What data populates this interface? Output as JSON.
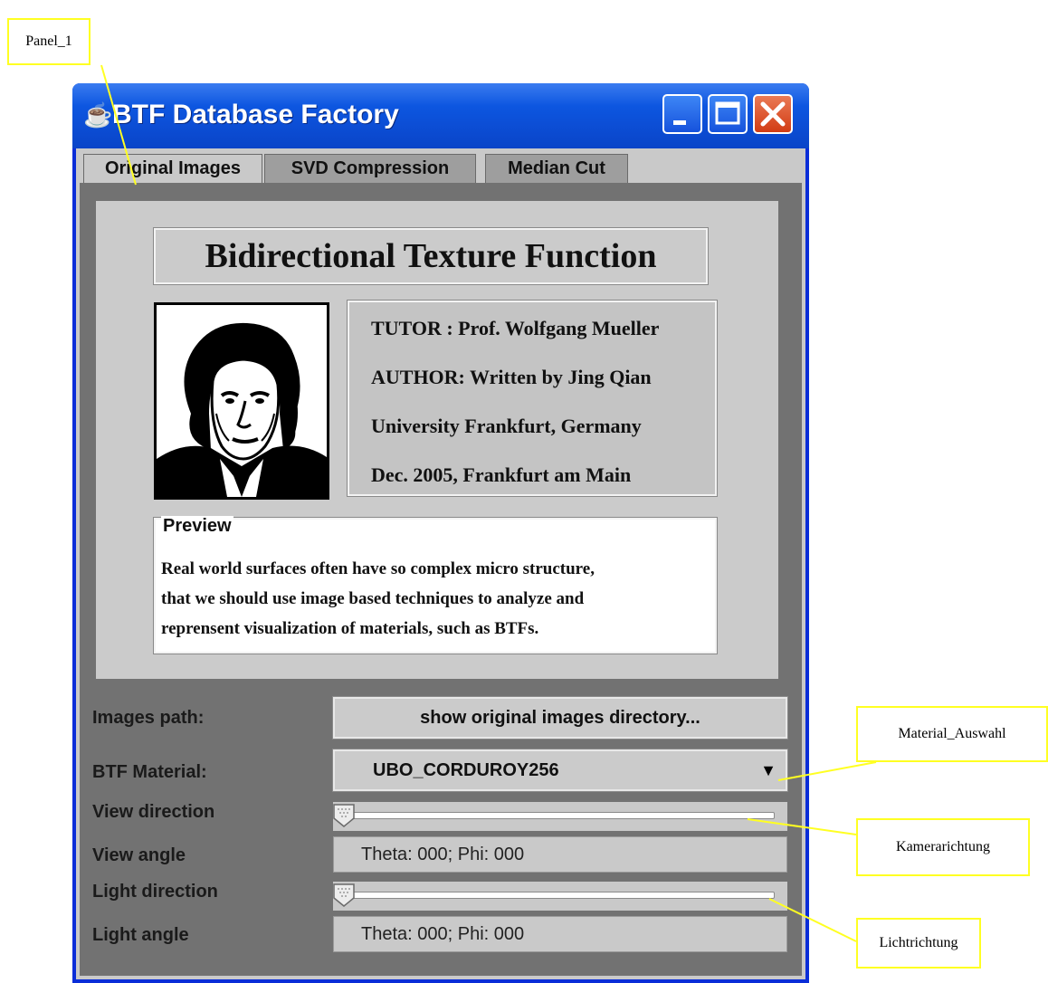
{
  "callouts": {
    "panel": "Panel_1",
    "material": "Material_Auswahl",
    "camera": "Kamerarichtung",
    "light": "Lichtrichtung"
  },
  "window": {
    "title": "BTF Database Factory",
    "icon": "java-cup-icon"
  },
  "tabs": [
    {
      "label": "Original Images",
      "active": true
    },
    {
      "label": "SVD Compression",
      "active": false
    },
    {
      "label": "Median Cut",
      "active": false
    }
  ],
  "panel": {
    "heading": "Bidirectional Texture Function",
    "portrait_icon": "goethe-portrait-icon",
    "info": [
      "TUTOR : Prof. Wolfgang Mueller",
      "AUTHOR: Written by Jing Qian",
      "University Frankfurt, Germany",
      "Dec. 2005, Frankfurt am Main"
    ],
    "preview": {
      "legend": "Preview",
      "lines": [
        "Real world surfaces often have so complex micro structure,",
        "that we should use image based techniques to analyze and",
        "reprensent visualization of materials, such as BTFs."
      ]
    }
  },
  "controls": {
    "images_path_label": "Images path:",
    "images_path_button": "show original images directory...",
    "material_label": "BTF Material:",
    "material_value": "UBO_CORDUROY256",
    "view_direction_label": "View direction",
    "view_direction_value": 0,
    "view_angle_label": "View angle",
    "view_angle_value": "Theta: 000; Phi: 000",
    "light_direction_label": "Light direction",
    "light_direction_value": 0,
    "light_angle_label": "Light angle",
    "light_angle_value": "Theta: 000; Phi: 000"
  },
  "colors": {
    "titlebar": "#0a44c8",
    "panel_bg": "#727272",
    "callout_border": "#ffff22"
  }
}
